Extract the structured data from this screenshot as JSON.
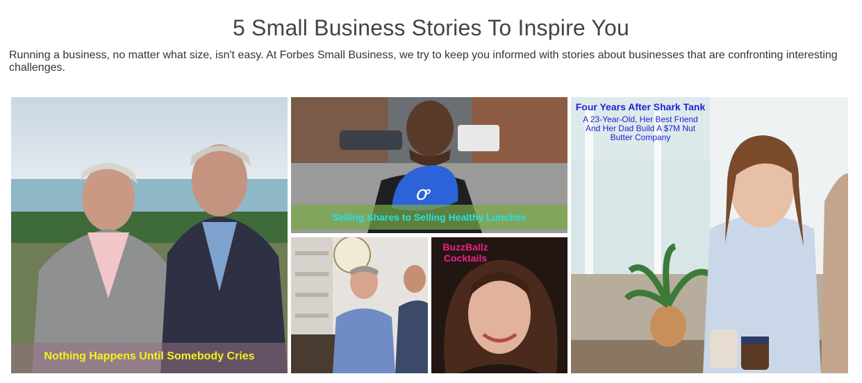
{
  "page": {
    "title": "5 Small Business Stories To Inspire You",
    "intro": "Running a business, no matter what size, isn't easy. At Forbes Small Business, we try to keep you informed with stories about businesses that are confronting interesting challenges."
  },
  "stories": [
    {
      "caption": "Nothing Happens Until Somebody Cries",
      "caption_color": "#f6f21a"
    },
    {
      "caption": "Selling Shares to Selling Healthy Lunches",
      "caption_color": "#22e3ee"
    },
    {
      "caption": "",
      "caption_color": ""
    },
    {
      "caption": "BuzzBallz Cocktails",
      "caption_color": "#ee1f8a"
    },
    {
      "caption": "Four Years After Shark Tank",
      "subtitle": "A 23-Year-Old, Her Best Friend And Her Dad Build A $7M Nut Butter Company",
      "caption_color": "#1d1fd6"
    }
  ]
}
